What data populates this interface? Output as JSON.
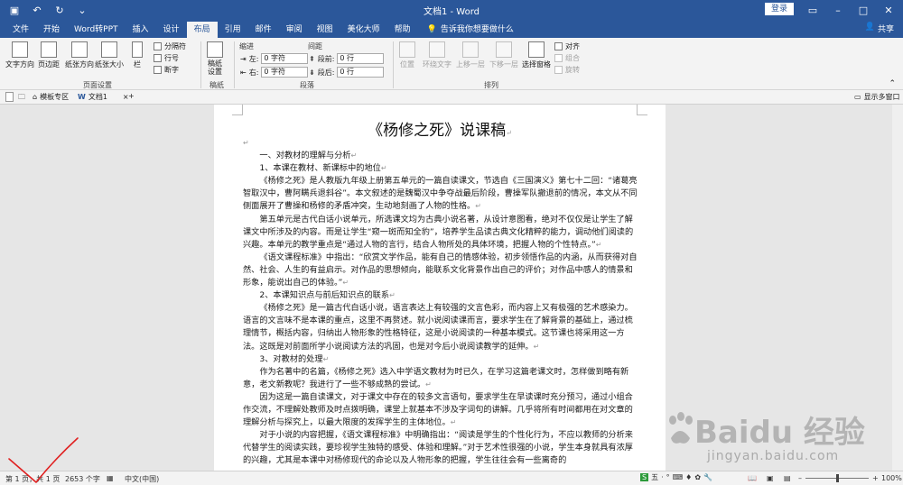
{
  "window": {
    "title": "文档1  -  Word",
    "login": "登录",
    "share": "共享",
    "controls": [
      "▭",
      "–",
      "□",
      "✕"
    ]
  },
  "tabs": [
    "文件",
    "开始",
    "Word转PPT",
    "插入",
    "设计",
    "布局",
    "引用",
    "邮件",
    "审阅",
    "视图",
    "美化大师",
    "帮助"
  ],
  "tellme": "告诉我你想要做什么",
  "ribbon": {
    "page_setup": {
      "text_direction": "文字方向",
      "margins": "页边距",
      "orientation": "纸张方向",
      "size": "纸张大小",
      "columns": "栏",
      "breaks": "分隔符",
      "line_numbers": "行号",
      "hyphenation": "断字",
      "label": "页面设置"
    },
    "manuscript": {
      "button": "稿纸\n设置",
      "label": "稿纸"
    },
    "paragraph": {
      "indent_header": "缩进",
      "spacing_header": "间距",
      "indent_left_label": "左:",
      "indent_left_value": "0 字符",
      "indent_right_label": "右:",
      "indent_right_value": "0 字符",
      "before_label": "段前:",
      "before_value": "0 行",
      "after_label": "段后:",
      "after_value": "0 行",
      "label": "段落"
    },
    "arrange": {
      "position": "位置",
      "wrap_text": "环绕文字",
      "bring_forward": "上移一层",
      "send_backward": "下移一层",
      "selection_pane": "选择窗格",
      "align": "对齐",
      "group": "组合",
      "rotate": "旋转",
      "label": "排列"
    }
  },
  "doc_tabs": {
    "template": "模板专区",
    "document": "文档1",
    "show_multi": "显示多窗口"
  },
  "document": {
    "title": "《杨修之死》说课稿",
    "paragraphs": [
      "一、对教材的理解与分析",
      "1、本课在教材、新课标中的地位",
      "《杨修之死》是人教版九年级上册第五单元的一篇自读课文，节选自《三国演义》第七十二回：“诸葛亮智取汉中，曹阿瞒兵退斜谷”。本文叙述的是魏蜀汉中争夺战最后阶段，曹操军队撤退前的情况，本文从不同侧面展开了曹操和杨修的矛盾冲突，生动地刻画了人物的性格。",
      "第五单元是古代白话小说单元，所选课文均为古典小说名著，从设计意图看，绝对不仅仅是让学生了解课文中所涉及的内容。而是让学生“窥一斑而知全豹”，培养学生品读古典文化精粹的能力，调动他们阅读的兴趣。本单元的教学重点是“通过人物的言行，结合人物所处的具体环境，把握人物的个性特点。”",
      "《语文课程标准》中指出：“欣赏文学作品，能有自己的情感体验，初步领悟作品的内涵，从而获得对自然、社会、人生的有益启示。对作品的思想倾向，能联系文化背景作出自己的评价；对作品中感人的情景和形象，能说出自己的体验。”",
      "2、本课知识点与前后知识点的联系",
      "《杨修之死》是一篇古代白话小说，语言表达上有较强的文言色彩，而内容上又有极强的艺术感染力。语言的文言味不是本课的重点，这里不再赘述。就小说阅读课而言，要求学生在了解背景的基础上，通过梳理情节，概括内容，归纳出人物形象的性格特征，这是小说阅读的一种基本模式。这节课也将采用这一方法。这既是对前面所学小说阅读方法的巩固，也是对今后小说阅读教学的延伸。",
      "3、对教材的处理",
      "作为名著中的名篇，《杨修之死》选入中学语文教材为时已久，在学习这篇老课文时，怎样做到略有新意，老文新教呢？我进行了一些不够成熟的尝试。",
      "因为这是一篇自读课文，对于课文中存在的较多文言语句，要求学生在早读课时充分预习，通过小组合作交流，不理解处教师及时点拨明确，课堂上就基本不涉及字词句的讲解。几乎将所有时间都用在对文章的理解分析与探究上，以最大限度的发挥学生的主体地位。",
      "对于小说的内容把握，《语文课程标准》中明确指出：“阅读是学生的个性化行为，不应以教师的分析来代替学生的阅读实践，要珍视学生独特的感受、体验和理解。”对于艺术性很强的小说，学生本身就具有浓厚的兴趣，尤其是本课中对杨修现代的命论以及人物形象的把握，学生往往会有一些离奇的"
    ]
  },
  "status": {
    "page": "第 1 页，共 1 页",
    "words": "2653 个字",
    "language": "中文(中国)",
    "ime": [
      "五",
      "·",
      "°",
      "⌨",
      "♦",
      "✿"
    ],
    "zoom_minus": "–",
    "zoom_plus": "+",
    "zoom": "100%"
  },
  "watermark": {
    "main": "Baidu 经验",
    "url": "jingyan.baidu.com"
  }
}
